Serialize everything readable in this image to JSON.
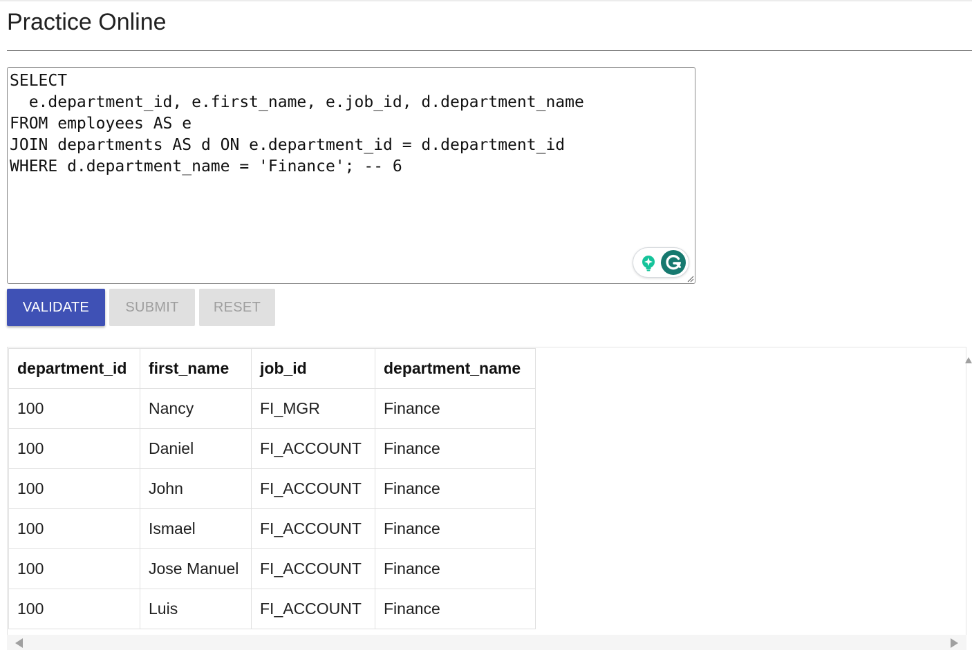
{
  "page": {
    "title": "Practice Online"
  },
  "editor": {
    "query": "SELECT\n  e.department_id, e.first_name, e.job_id, d.department_name\nFROM employees AS e\nJOIN departments AS d ON e.department_id = d.department_id\nWHERE d.department_name = 'Finance'; -- 6"
  },
  "buttons": {
    "validate": "VALIDATE",
    "submit": "SUBMIT",
    "reset": "RESET"
  },
  "results": {
    "columns": [
      "department_id",
      "first_name",
      "job_id",
      "department_name"
    ],
    "rows": [
      [
        "100",
        "Nancy",
        "FI_MGR",
        "Finance"
      ],
      [
        "100",
        "Daniel",
        "FI_ACCOUNT",
        "Finance"
      ],
      [
        "100",
        "John",
        "FI_ACCOUNT",
        "Finance"
      ],
      [
        "100",
        "Ismael",
        "FI_ACCOUNT",
        "Finance"
      ],
      [
        "100",
        "Jose Manuel",
        "FI_ACCOUNT",
        "Finance"
      ],
      [
        "100",
        "Luis",
        "FI_ACCOUNT",
        "Finance"
      ]
    ]
  },
  "icons": {
    "grammarly_suggest": "lightbulb-sparkle-icon",
    "grammarly_logo": "grammarly-g-icon",
    "resize": "resize-grip-icon",
    "scroll_left": "scroll-left-arrow-icon",
    "scroll_right": "scroll-right-arrow-icon",
    "scroll_up": "scroll-up-arrow-icon"
  },
  "colors": {
    "primary": "#3f51b5",
    "disabled_bg": "#e0e0e0",
    "disabled_text": "#9e9e9e",
    "grammarly_green": "#16796f",
    "grammarly_bulb": "#15c39a"
  }
}
